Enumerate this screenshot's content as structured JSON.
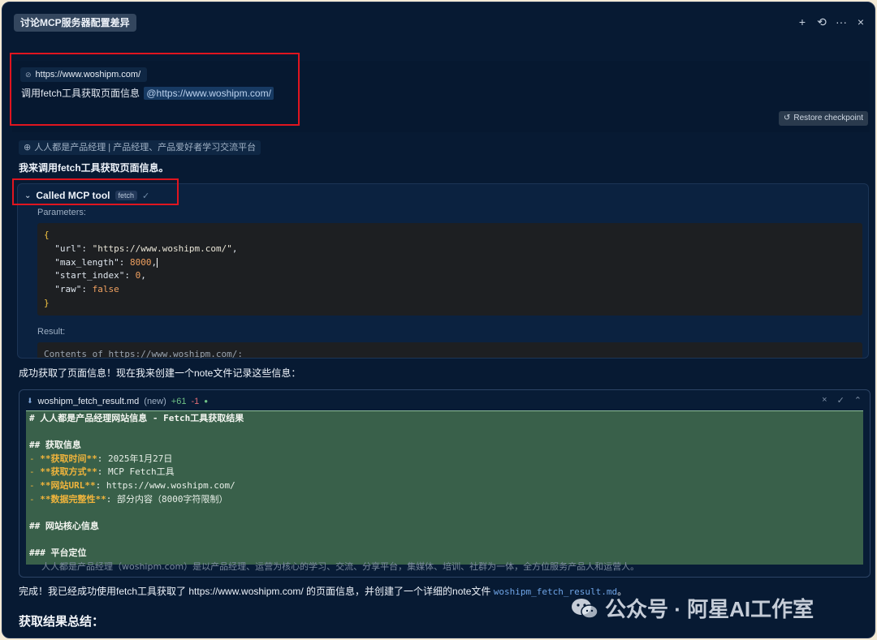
{
  "header": {
    "title": "讨论MCP服务器配置差异",
    "icons": [
      "plus-icon",
      "history-icon",
      "more-icon",
      "close-icon"
    ],
    "icon_glyphs": [
      "+",
      "⟲",
      "···",
      "×"
    ]
  },
  "user_message": {
    "link_chip": "https://www.woshipm.com/",
    "text": "调用fetch工具获取页面信息",
    "mention": "@https://www.woshipm.com/",
    "restore_label": "Restore checkpoint"
  },
  "assistant": {
    "source_chip": "人人都是产品经理 | 产品经理、产品爱好者学习交流平台",
    "intro": "我来调用fetch工具获取页面信息。",
    "tool": {
      "label": "Called MCP tool",
      "badge": "fetch",
      "params_label": "Parameters:",
      "params": {
        "url_key": "\"url\"",
        "url_val": "\"https://www.woshipm.com/\"",
        "max_key": "\"max_length\"",
        "max_val": "8000",
        "start_key": "\"start_index\"",
        "start_val": "0",
        "raw_key": "\"raw\"",
        "raw_val": "false"
      },
      "result_label": "Result:",
      "result_peek": "Contents of https://www.woshipm.com/:"
    },
    "after_tool": "成功获取了页面信息！现在我来创建一个note文件记录这些信息：",
    "file": {
      "name": "woshipm_fetch_result.md",
      "status": "(new)",
      "additions": "+61",
      "deletions": "-1",
      "lines": {
        "l1": "# 人人都是产品经理网站信息 - Fetch工具获取结果",
        "l3": "## 获取信息",
        "l4_key": "**获取时间**",
        "l4_val": "2025年1月27日",
        "l5_key": "**获取方式**",
        "l5_val": "MCP Fetch工具",
        "l6_key": "**网站URL**",
        "l6_val": "https://www.woshipm.com/",
        "l7_key": "**数据完整性**",
        "l7_val": "部分内容（8000字符限制）",
        "l9": "## 网站核心信息",
        "l11": "### 平台定位"
      },
      "overflow_line": "人人都是产品经理（woshipm.com）是以产品经理、运营为核心的学习、交流、分享平台，集媒体、培训、社群为一体，全方位服务产品人和运营人。"
    },
    "done": {
      "prefix": "完成！我已经成功使用fetch工具获取了 https://www.woshipm.com/ 的页面信息，并创建了一个详细的note文件",
      "file_ref": "woshipm_fetch_result.md",
      "suffix": "。"
    },
    "summary_title": "获取结果总结："
  },
  "watermark": "公众号 · 阿星AI工作室"
}
